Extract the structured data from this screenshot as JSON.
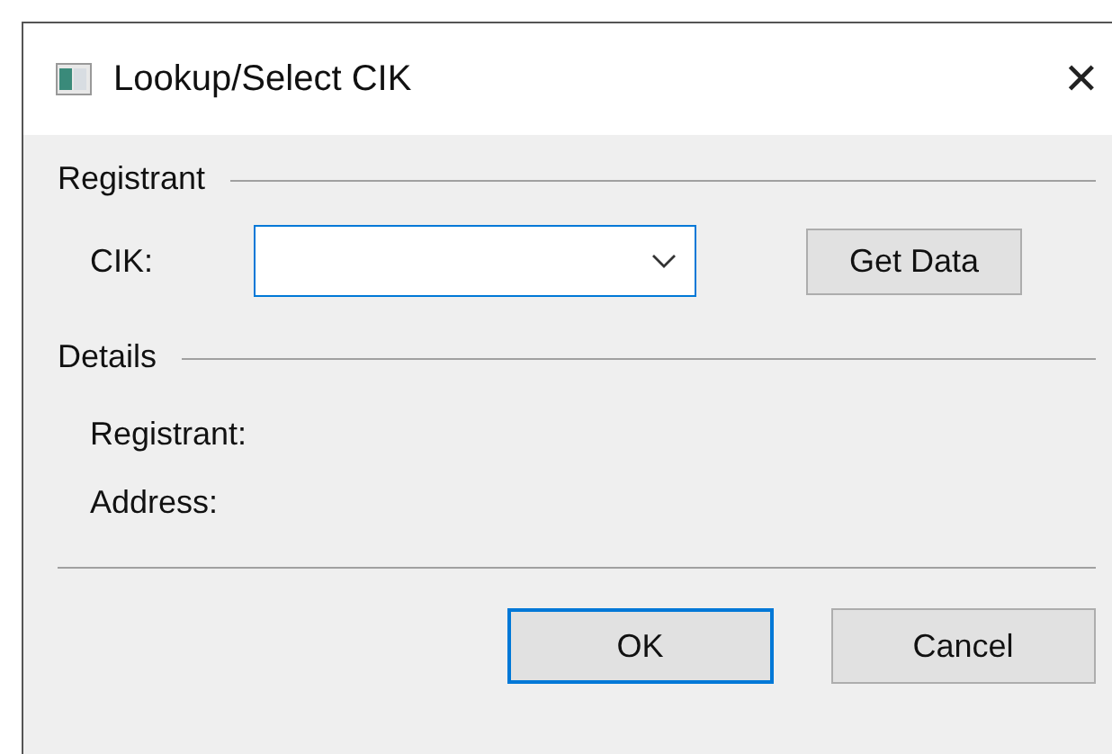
{
  "window": {
    "title": "Lookup/Select CIK",
    "close": "✕"
  },
  "registrant_group": {
    "heading": "Registrant",
    "cik_label": "CIK:",
    "cik_field": {
      "focused": true
    },
    "get_data_button": "Get Data"
  },
  "details_group": {
    "heading": "Details",
    "labels": [
      "Registrant:",
      "Address:"
    ]
  },
  "buttons": [
    {
      "label": "OK",
      "default": true
    },
    {
      "label": "Cancel",
      "default": false
    }
  ]
}
